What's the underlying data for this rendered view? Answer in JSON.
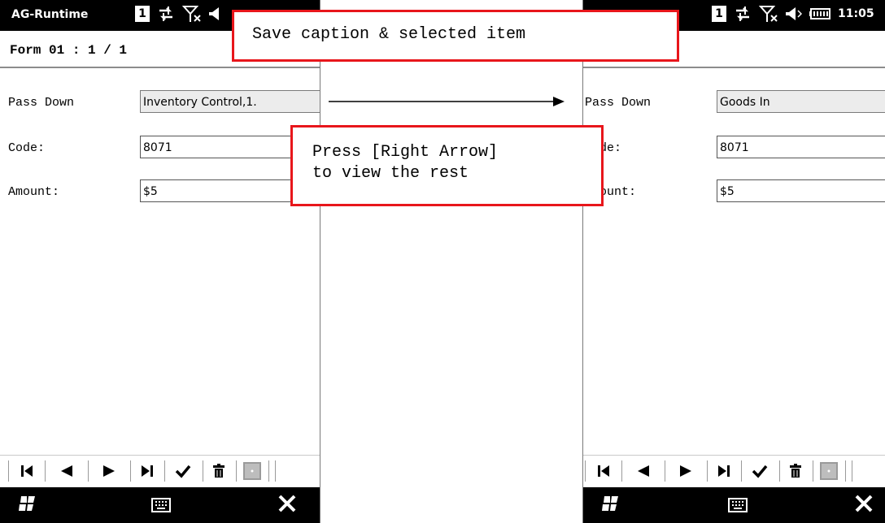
{
  "app_title": "AG-Runtime",
  "clock": "11:05",
  "form_caption": "Form 01 : 1 / 1",
  "left_screen": {
    "fields": [
      {
        "label": "Pass Down",
        "value": "Inventory Control,1."
      },
      {
        "label": "Code:",
        "value": "8071"
      },
      {
        "label": "Amount:",
        "value": "$5"
      }
    ]
  },
  "right_screen": {
    "fields": [
      {
        "label": "Pass Down",
        "value": "Goods In"
      },
      {
        "label": "Code:",
        "value": "8071"
      },
      {
        "label": "Amount:",
        "value": "$5"
      }
    ]
  },
  "annotations": {
    "save": "Save caption & selected item",
    "press_line1": "Press [Right Arrow]",
    "press_line2": "to view the rest"
  },
  "icons": {
    "status": [
      "sim-1-icon",
      "data-sync-icon",
      "no-signal-icon",
      "speaker-icon",
      "battery-icon"
    ],
    "nav": [
      "first-record-icon",
      "prev-record-icon",
      "next-record-icon",
      "last-record-icon",
      "confirm-icon",
      "delete-icon",
      "scanner-icon"
    ],
    "taskbar": [
      "windows-start-icon",
      "keyboard-icon",
      "close-icon"
    ]
  },
  "colors": {
    "annotation_border": "#e8161b",
    "statusbar": "#000000",
    "readonly_field": "#ececec"
  }
}
